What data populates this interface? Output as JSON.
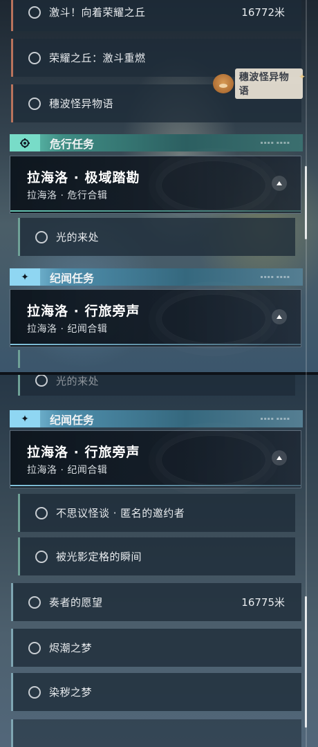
{
  "top_panel": {
    "rows": [
      {
        "title": "激斗！向着荣耀之丘",
        "distance": "16772米"
      },
      {
        "title": "荣耀之丘：激斗重燃"
      },
      {
        "title": "穗波怪异物语"
      }
    ],
    "badge_text": "穗波怪异物语",
    "danger_category": {
      "label": "危行任务",
      "icon": "eye-gear-icon"
    },
    "danger_card": {
      "title": "拉海洛 · 极域踏勘",
      "subtitle": "拉海洛 · 危行合辑"
    },
    "danger_sub_row": {
      "title": "光的来处"
    },
    "chron_category": {
      "label": "纪闻任务",
      "icon": "sparkle-icon"
    },
    "chron_card": {
      "title": "拉海洛 · 行旅旁声",
      "subtitle": "拉海洛 · 纪闻合辑"
    }
  },
  "bottom_panel": {
    "partial_row": {
      "title": "光的来处"
    },
    "chron_category": {
      "label": "纪闻任务",
      "icon": "sparkle-icon"
    },
    "chron_card": {
      "title": "拉海洛 · 行旅旁声",
      "subtitle": "拉海洛 · 纪闻合辑"
    },
    "chron_sub_rows": [
      {
        "title": "不思议怪谈 · 匿名的邀约者"
      },
      {
        "title": "被光影定格的瞬间"
      }
    ],
    "rows": [
      {
        "title": "奏者的愿望",
        "distance": "16775米"
      },
      {
        "title": "烬潮之梦"
      },
      {
        "title": "染秽之梦"
      }
    ]
  },
  "colors": {
    "danger_accent": "#6fd8c3",
    "chron_accent": "#8fd6f2",
    "row_accent_orange": "#b9735c",
    "row_accent_teal": "#6fa197"
  }
}
